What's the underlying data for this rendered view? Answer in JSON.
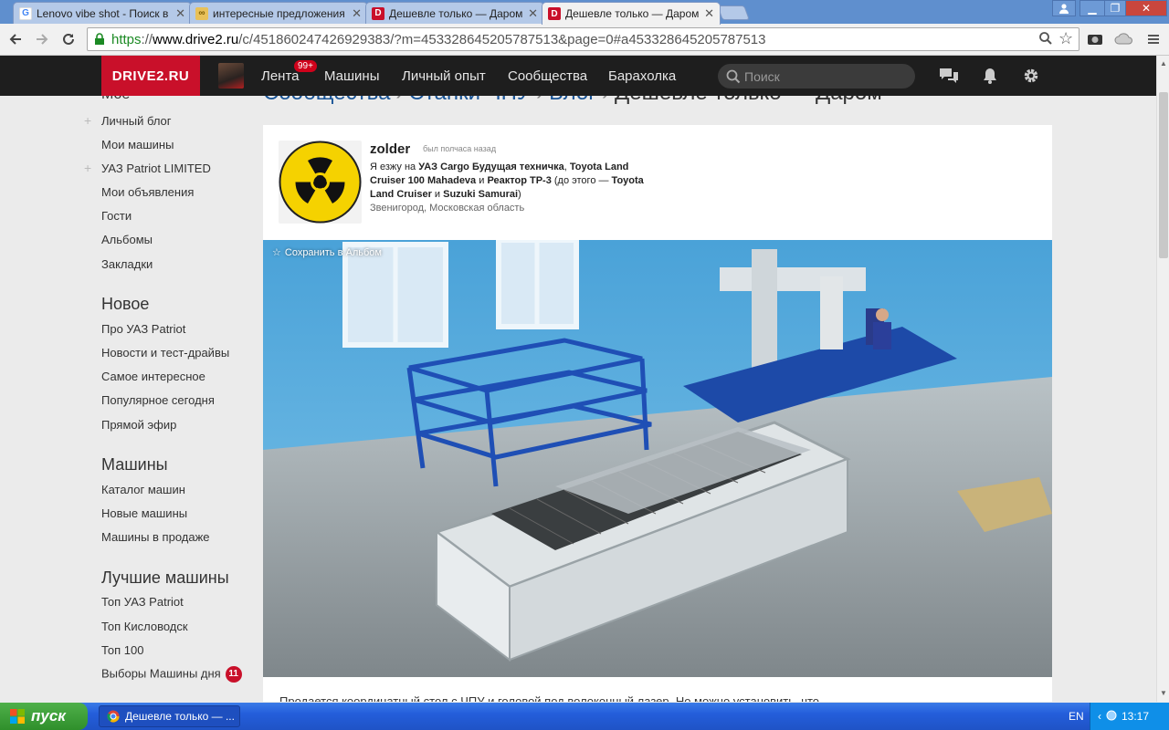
{
  "browser": {
    "tabs": [
      {
        "title": "Lenovo vibe shot - Поиск в Google",
        "favicon": "google-icon",
        "active": false
      },
      {
        "title": "интересные предложения",
        "favicon": "link-icon",
        "active": false
      },
      {
        "title": "Дешевле только — Даром",
        "favicon": "drive2-icon",
        "active": false
      },
      {
        "title": "Дешевле только — Даром",
        "favicon": "drive2-icon",
        "active": true
      }
    ],
    "url_scheme": "https",
    "url_host": "www.drive2.ru",
    "url_path": "/c/451860247426929383/?m=453328645205787513&page=0#a453328645205787513"
  },
  "site": {
    "logo": "DRIVE2.RU",
    "brand_color": "#c9102a",
    "nav": [
      {
        "label": "Лента"
      },
      {
        "label": "Машины"
      },
      {
        "label": "Личный опыт"
      },
      {
        "label": "Сообщества"
      },
      {
        "label": "Барахолка"
      }
    ],
    "feed_badge": "99+",
    "search_placeholder": "Поиск"
  },
  "sidebar": {
    "partial_top": "Моё",
    "group_my": [
      "Личный блог",
      "Мои машины",
      "УАЗ Patriot LIMITED",
      "Мои объявления",
      "Гости",
      "Альбомы",
      "Закладки"
    ],
    "head_new": "Новое",
    "group_new": [
      "Про УАЗ Patriot",
      "Новости и тест-драйвы",
      "Самое интересное",
      "Популярное сегодня",
      "Прямой эфир"
    ],
    "head_cars": "Машины",
    "group_cars": [
      "Каталог машин",
      "Новые машины",
      "Машины в продаже"
    ],
    "head_best": "Лучшие машины",
    "group_best": [
      "Топ УАЗ Patriot",
      "Топ Кисловодск",
      "Топ 100",
      "Выборы Машины дня"
    ],
    "day_badge": "11"
  },
  "breadcrumbs": {
    "items": [
      "Сообщества",
      "Станки ЧПУ",
      "Блог"
    ],
    "current": "Дешевле только — Даром",
    "separator": "›"
  },
  "author": {
    "name": "zolder",
    "last_seen": "был полчаса назад",
    "bio_prefix": "Я езжу на ",
    "car1": "УАЗ Cargo Будущая техничка",
    "car2": "Toyota Land Cruiser 100 Mahadeva",
    "and1": " и ",
    "car3": "Реактор ТР-3",
    "before_prefix": " (до этого — ",
    "car4": "Toyota Land Cruiser",
    "and2": " и ",
    "car5": "Suzuki Samurai",
    "close": ")",
    "city": "Звенигород, Московская область"
  },
  "post": {
    "save_label": "Сохранить в Альбом",
    "text_start": "Продается координатный стол с ЧПУ и головой под волоконный лазер. Но можно установить, что"
  },
  "taskbar": {
    "start_label": "пуск",
    "task_title": "Дешевле только — ...",
    "lang": "EN",
    "clock": "13:17"
  }
}
